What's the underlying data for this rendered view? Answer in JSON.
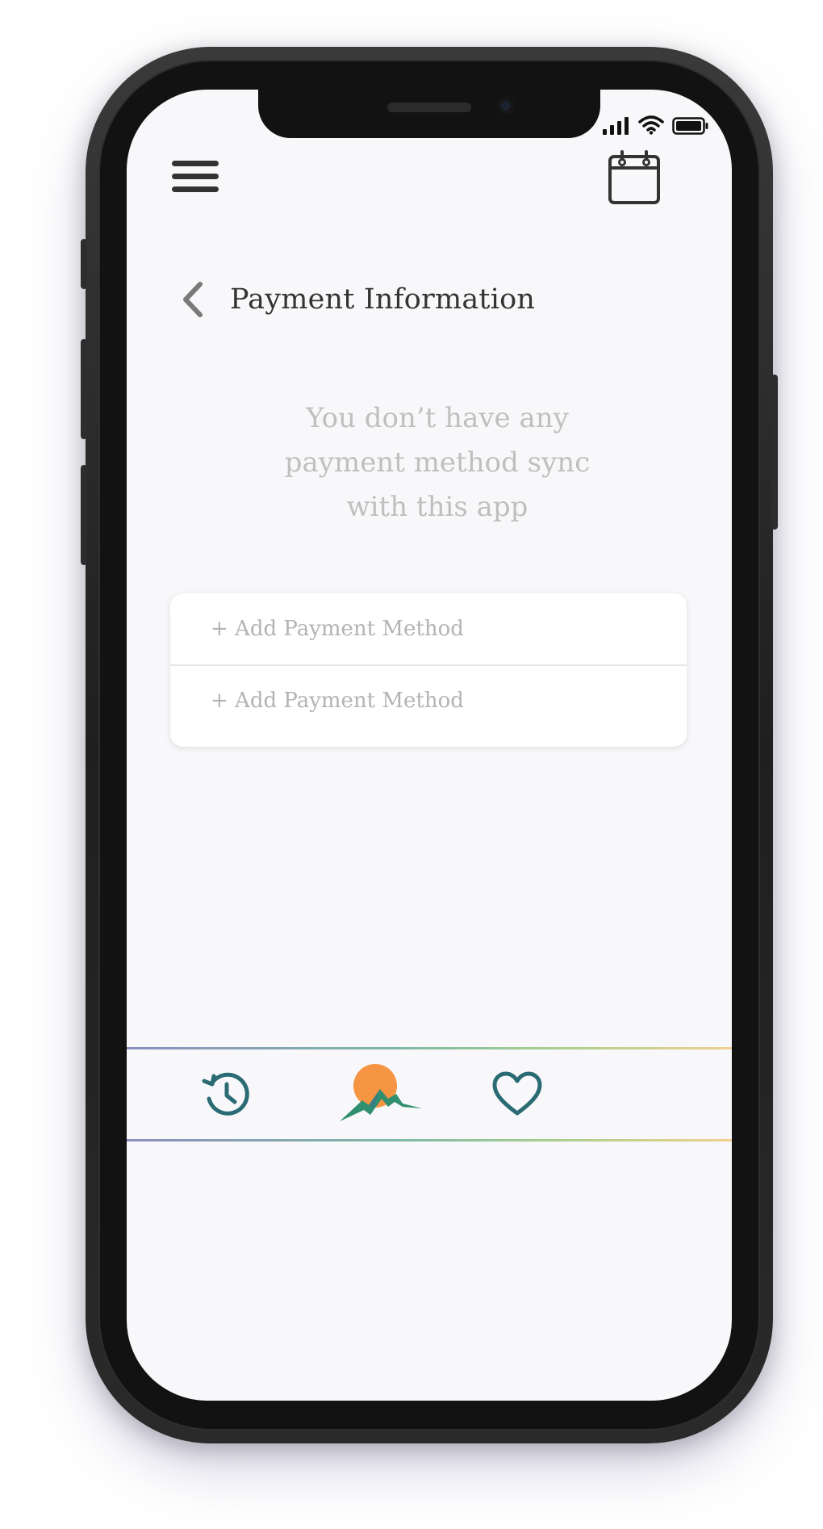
{
  "header": {
    "title": "Payment Information"
  },
  "empty_state": {
    "line1": "You don’t have any",
    "line2": "payment method sync",
    "line3": "with this app"
  },
  "payment_methods": [
    {
      "label": "+ Add Payment Method"
    },
    {
      "label": "+ Add Payment Method"
    }
  ],
  "tabbar": {
    "items": [
      "history-icon",
      "home-logo",
      "heart-icon"
    ]
  },
  "colors": {
    "accent_teal": "#2a6b74",
    "logo_orange": "#f59442",
    "logo_green": "#2f8f6f"
  }
}
